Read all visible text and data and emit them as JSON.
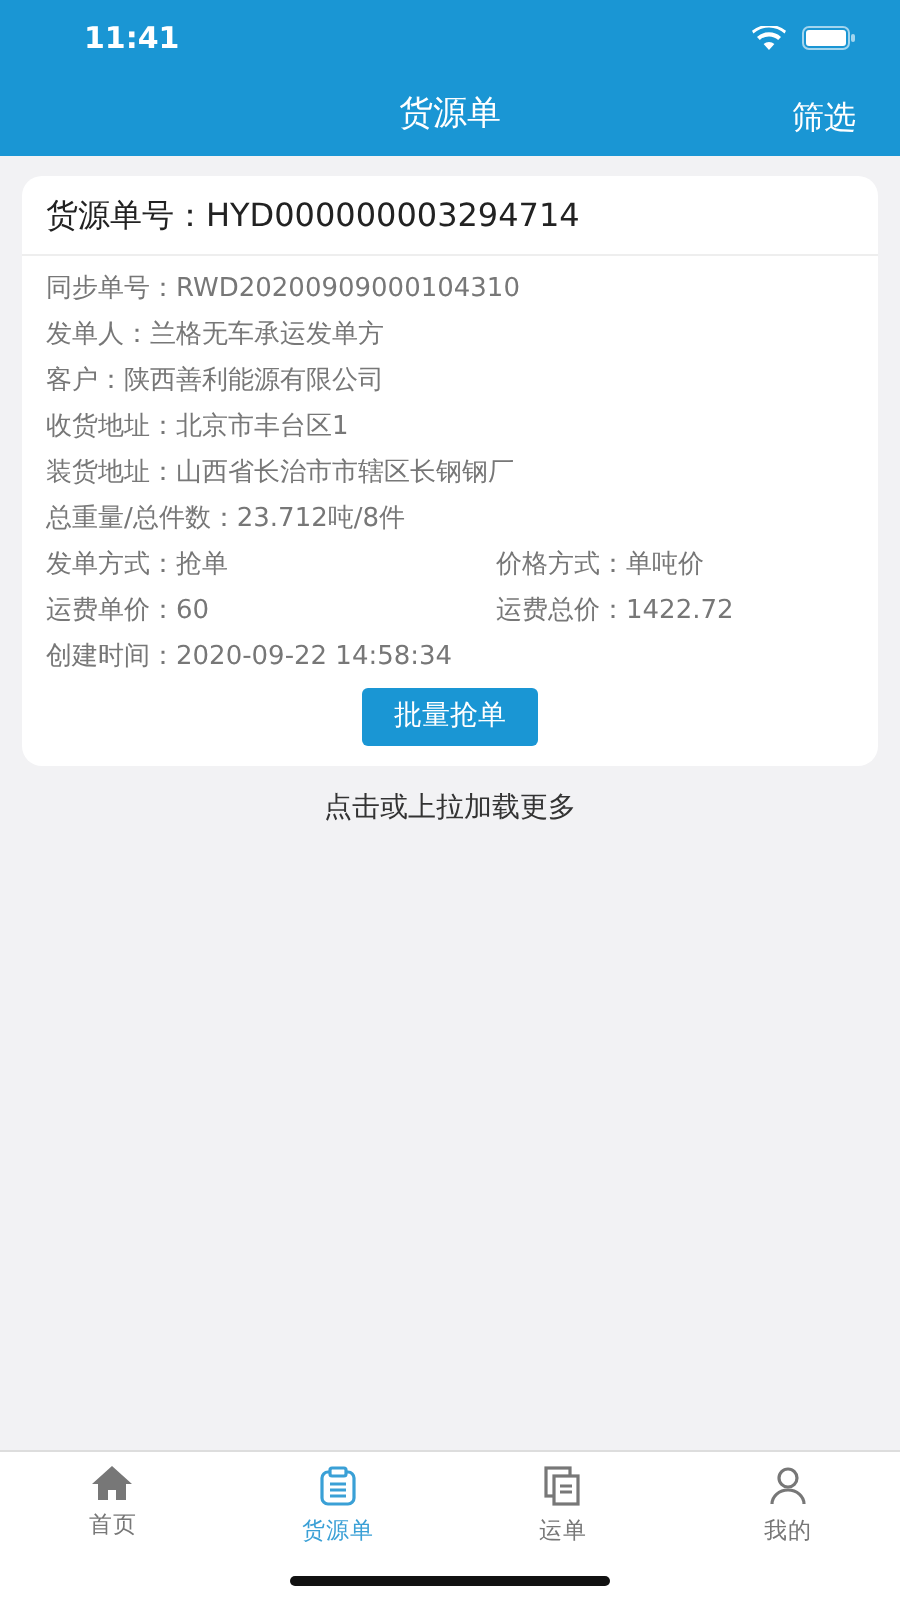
{
  "status_bar": {
    "time": "11:41"
  },
  "nav": {
    "title": "货源单",
    "action": "筛选"
  },
  "order": {
    "title": "货源单号：",
    "number": "HYD000000003294714",
    "rows": [
      {
        "cells": [
          {
            "label": "同步单号：",
            "value": "RWD20200909000104310"
          }
        ]
      },
      {
        "cells": [
          {
            "label": "发单人：",
            "value": "兰格无车承运发单方"
          }
        ]
      },
      {
        "cells": [
          {
            "label": "客户：",
            "value": "陕西善利能源有限公司"
          }
        ]
      },
      {
        "cells": [
          {
            "label": "收货地址：",
            "value": "北京市丰台区1"
          }
        ]
      },
      {
        "cells": [
          {
            "label": "装货地址：",
            "value": "山西省长治市市辖区长钢钢厂"
          }
        ]
      },
      {
        "cells": [
          {
            "label": "总重量/总件数：",
            "value": "23.712吨/8件"
          }
        ]
      },
      {
        "cells": [
          {
            "label": "发单方式：",
            "value": "抢单"
          },
          {
            "label": "价格方式：",
            "value": "单吨价"
          }
        ]
      },
      {
        "cells": [
          {
            "label": "运费单价：",
            "value": "60"
          },
          {
            "label": "运费总价：",
            "value": "1422.72"
          }
        ]
      },
      {
        "cells": [
          {
            "label": "创建时间：",
            "value": "2020-09-22 14:58:34"
          }
        ]
      }
    ],
    "button": "批量抢单"
  },
  "load_more": "点击或上拉加载更多",
  "tabs": [
    {
      "label": "首页",
      "selected": false
    },
    {
      "label": "货源单",
      "selected": true
    },
    {
      "label": "运单",
      "selected": false
    },
    {
      "label": "我的",
      "selected": false
    }
  ]
}
